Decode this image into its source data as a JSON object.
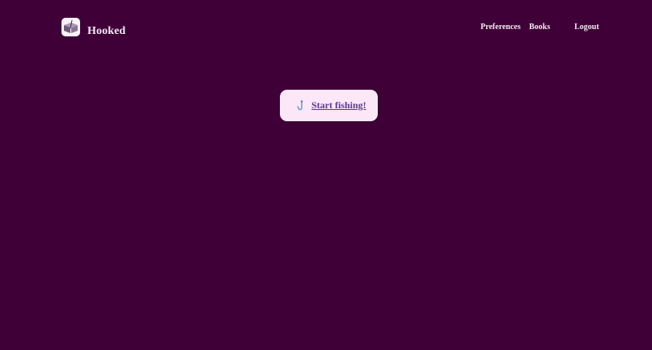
{
  "app": {
    "name": "Hooked",
    "logo_icon": "open-book-logo-icon"
  },
  "nav": {
    "preferences": "Preferences",
    "books": "Books",
    "logout": "Logout"
  },
  "main": {
    "cta_label": "Start fishing!",
    "cta_icon": "fishing-hook-icon"
  },
  "colors": {
    "background": "#3f0037",
    "button_background": "#fbe7f8",
    "button_text": "#5a3896",
    "nav_text": "#f4eaf2"
  }
}
